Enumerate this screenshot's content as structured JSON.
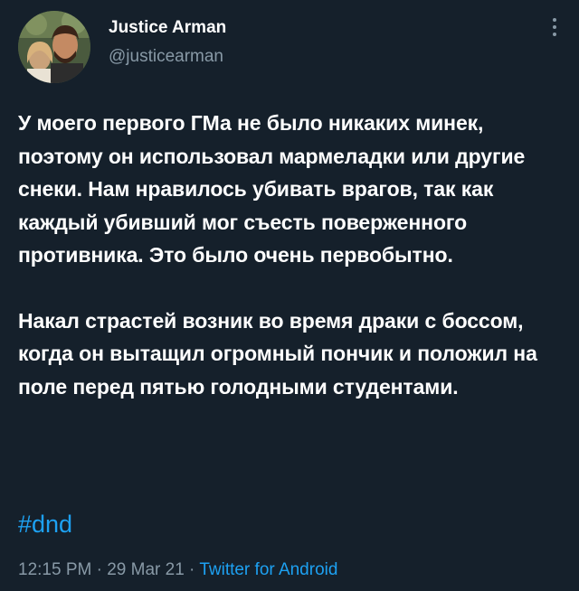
{
  "tweet": {
    "author": {
      "display_name": "Justice Arman",
      "handle": "@justicearman"
    },
    "paragraphs": [
      "У моего первого ГМа не было никаких минек, поэтому он использовал мармеладки или другие снеки. Нам нравилось убивать врагов, так как каждый убивший мог съесть поверженного противника. Это было очень первобытно.",
      "Накал страстей возник во время драки с боссом, когда он вытащил огромный пончик и положил на поле перед пятью голодными студентами."
    ],
    "hashtag": "#dnd",
    "time": "12:15 PM",
    "separator": " · ",
    "date": "29 Mar 21",
    "source": "Twitter for Android"
  },
  "colors": {
    "background": "#15202b",
    "text": "#ffffff",
    "secondary": "#8899a6",
    "accent": "#1da1f2"
  },
  "icons": {
    "more": "more-vertical-icon",
    "avatar": "avatar-photo"
  }
}
